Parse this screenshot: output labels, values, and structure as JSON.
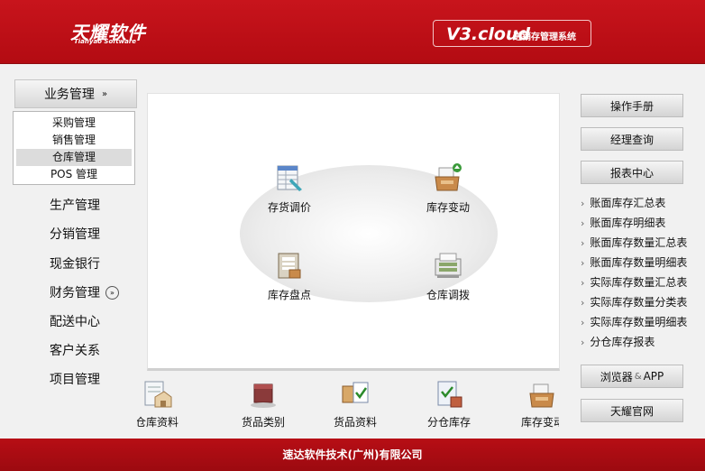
{
  "header": {
    "brand_cn": "天耀软件",
    "brand_en": "Tianyao Software",
    "version": "V3.cloud",
    "system_name": "进销存管理系统"
  },
  "nav": {
    "top_label": "业务管理",
    "submenu": [
      {
        "label": "采购管理"
      },
      {
        "label": "销售管理"
      },
      {
        "label": "仓库管理"
      },
      {
        "label": "POS 管理"
      }
    ],
    "active_submenu": "仓库管理",
    "items": [
      {
        "label": "生产管理"
      },
      {
        "label": "分销管理"
      },
      {
        "label": "现金银行"
      },
      {
        "label": "财务管理"
      },
      {
        "label": "配送中心"
      },
      {
        "label": "客户关系"
      },
      {
        "label": "项目管理"
      }
    ]
  },
  "center": {
    "items": [
      {
        "label": "存货调价",
        "icon": "price-adjust-icon"
      },
      {
        "label": "库存变动",
        "icon": "inventory-change-icon"
      },
      {
        "label": "库存盘点",
        "icon": "stock-count-icon"
      },
      {
        "label": "仓库调拨",
        "icon": "warehouse-transfer-icon"
      }
    ]
  },
  "strip": {
    "items": [
      {
        "label": "仓库资料",
        "icon": "warehouse-data-icon"
      },
      {
        "label": "货品类别",
        "icon": "goods-category-icon"
      },
      {
        "label": "货品资料",
        "icon": "goods-data-icon"
      },
      {
        "label": "分仓库存",
        "icon": "branch-stock-icon"
      },
      {
        "label": "库存变动",
        "icon": "inventory-change-icon"
      }
    ]
  },
  "right": {
    "manual": "操作手册",
    "manager_query": "经理查询",
    "report_center": "报表中心",
    "reports": [
      {
        "label": "账面库存汇总表"
      },
      {
        "label": "账面库存明细表"
      },
      {
        "label": "账面库存数量汇总表"
      },
      {
        "label": "账面库存数量明细表"
      },
      {
        "label": "实际库存数量汇总表"
      },
      {
        "label": "实际库存数量分类表"
      },
      {
        "label": "实际库存数量明细表"
      },
      {
        "label": "分仓库存报表"
      }
    ],
    "browser_app_a": "浏览器",
    "browser_app_amp": "&",
    "browser_app_b": "APP",
    "official_site": "天耀官网"
  },
  "footer": {
    "company": "速达软件技术(广州)有限公司"
  },
  "colors": {
    "brand_red": "#c8141c",
    "panel_bg": "#f1f1f1"
  }
}
